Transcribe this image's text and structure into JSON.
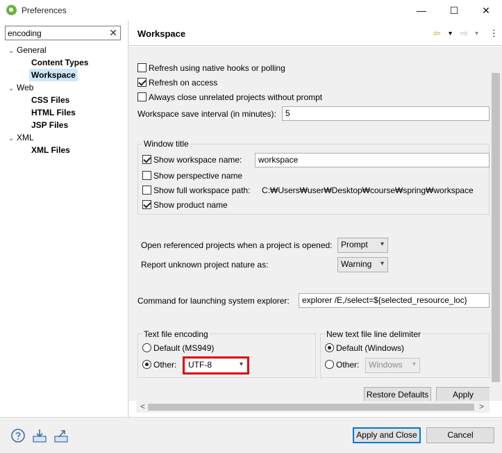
{
  "window": {
    "title": "Preferences",
    "minimize_glyph": "—",
    "maximize_glyph": "☐",
    "close_glyph": "✕"
  },
  "filter": {
    "value": "encoding",
    "clear_glyph": "✕"
  },
  "tree": {
    "general": {
      "label": "General",
      "children": [
        "Content Types",
        "Workspace"
      ]
    },
    "web": {
      "label": "Web",
      "children": [
        "CSS Files",
        "HTML Files",
        "JSP Files"
      ]
    },
    "xml": {
      "label": "XML",
      "children": [
        "XML Files"
      ]
    },
    "selected": "Workspace",
    "expanded_glyph": "⌄"
  },
  "page": {
    "title": "Workspace",
    "nav_back_glyph": "⇦",
    "nav_forward_glyph": "⇨",
    "menu_glyph": "⋮",
    "dropdown_glyph": "▾"
  },
  "options": {
    "refresh_native": {
      "label": "Refresh using native hooks or polling",
      "checked": false
    },
    "refresh_access": {
      "label": "Refresh on access",
      "checked": true
    },
    "always_close": {
      "label": "Always close unrelated projects without prompt",
      "checked": false
    },
    "save_interval_label": "Workspace save interval (in minutes):",
    "save_interval_value": "5"
  },
  "window_title": {
    "group_label": "Window title",
    "show_workspace_name": {
      "label": "Show workspace name:",
      "checked": true,
      "value": "workspace"
    },
    "show_perspective_name": {
      "label": "Show perspective name",
      "checked": false
    },
    "show_full_path": {
      "label": "Show full workspace path:",
      "checked": false,
      "value": "C:₩Users₩user₩Desktop₩course₩spring₩workspace"
    },
    "show_product_name": {
      "label": "Show product name",
      "checked": true
    }
  },
  "projects": {
    "open_referenced_label": "Open referenced projects when a project is opened:",
    "open_referenced_value": "Prompt",
    "report_unknown_label": "Report unknown project nature as:",
    "report_unknown_value": "Warning"
  },
  "explorer": {
    "label": "Command for launching system explorer:",
    "value": "explorer /E,/select=${selected_resource_loc}"
  },
  "encoding": {
    "group_label": "Text file encoding",
    "default_label": "Default (MS949)",
    "other_label": "Other:",
    "other_value": "UTF-8",
    "selected": "other",
    "highlight_color": "#e00000"
  },
  "line_delimiter": {
    "group_label": "New text file line delimiter",
    "default_label": "Default (Windows)",
    "other_label": "Other:",
    "other_value": "Windows",
    "selected": "default"
  },
  "buttons": {
    "restore_defaults": "Restore Defaults",
    "apply": "Apply",
    "apply_and_close": "Apply and Close",
    "cancel": "Cancel"
  },
  "scroll": {
    "left_glyph": "<",
    "right_glyph": ">"
  },
  "bottom_icons": [
    "help-icon",
    "import-icon",
    "export-icon"
  ],
  "colors": {
    "accent": "#0078d7",
    "selection": "#cce8ff",
    "spring_green": "#6db33f"
  }
}
